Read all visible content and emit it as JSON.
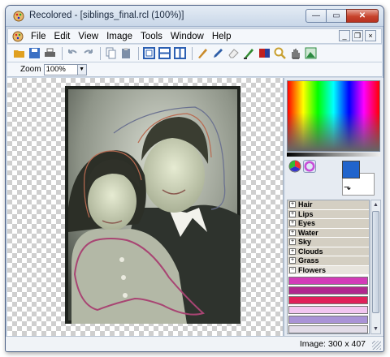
{
  "window": {
    "title": "Recolored - [siblings_final.rcl (100%)]",
    "controls": {
      "minimize": "—",
      "maximize": "▭",
      "close": "✕"
    }
  },
  "menubar": {
    "items": [
      "File",
      "Edit",
      "View",
      "Image",
      "Tools",
      "Window",
      "Help"
    ],
    "mdi_controls": [
      "_",
      "❐",
      "×"
    ]
  },
  "toolbar": {
    "buttons": [
      {
        "icon": "open-folder-icon",
        "color": "#e0a020"
      },
      {
        "icon": "save-icon",
        "color": "#3a6fc4"
      },
      {
        "icon": "print-icon",
        "color": "#666666"
      },
      {
        "icon": "undo-icon",
        "color": "#8a9bb0"
      },
      {
        "icon": "redo-icon",
        "color": "#8a9bb0"
      },
      {
        "icon": "copy-icon",
        "color": "#7d8fa8"
      },
      {
        "icon": "paste-icon",
        "color": "#7d8fa8"
      },
      {
        "icon": "view-single-icon",
        "color": "#2b5fb3"
      },
      {
        "icon": "view-horizontal-icon",
        "color": "#2b5fb3"
      },
      {
        "icon": "view-vertical-icon",
        "color": "#2b5fb3"
      },
      {
        "icon": "brush-icon",
        "color": "#c98a2a"
      },
      {
        "icon": "pencil-icon",
        "color": "#2f5fa8"
      },
      {
        "icon": "eraser-icon",
        "color": "#999999"
      },
      {
        "icon": "pen-icon",
        "color": "#2f8a2f"
      },
      {
        "icon": "color-fill-icon",
        "color": "#c02020"
      },
      {
        "icon": "magnifier-icon",
        "color": "#c8a030"
      },
      {
        "icon": "hand-icon",
        "color": "#444444"
      },
      {
        "icon": "fit-image-icon",
        "color": "#2b8a40"
      }
    ]
  },
  "zoom": {
    "label": "Zoom",
    "value": "100%",
    "dropdown": "▼"
  },
  "palette": {
    "foreground": "#2164cc",
    "background": "#ffffff",
    "swap": "⬎"
  },
  "layers": [
    {
      "name": "Hair",
      "expanded": false,
      "toggle": "+"
    },
    {
      "name": "Lips",
      "expanded": false,
      "toggle": "+"
    },
    {
      "name": "Eyes",
      "expanded": false,
      "toggle": "+"
    },
    {
      "name": "Water",
      "expanded": false,
      "toggle": "+"
    },
    {
      "name": "Sky",
      "expanded": false,
      "toggle": "+"
    },
    {
      "name": "Clouds",
      "expanded": false,
      "toggle": "+"
    },
    {
      "name": "Grass",
      "expanded": false,
      "toggle": "+"
    },
    {
      "name": "Flowers",
      "expanded": true,
      "toggle": "−"
    }
  ],
  "flower_swatches": [
    "#d23bb8",
    "#b0288e",
    "#e0205a",
    "#f2c6f0",
    "#a993d6",
    "#e2dce8"
  ],
  "scroll": {
    "up": "▲",
    "down": "▼"
  },
  "status": {
    "image_info": "Image: 300 x 407"
  }
}
